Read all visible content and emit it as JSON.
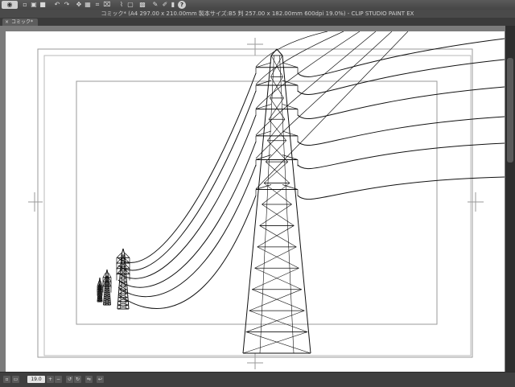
{
  "window": {
    "title": "コミック* (A4 297.00 x 210.00mm 製本サイズ:B5 判 257.00 x 182.00mm 600dpi 19.0%) - CLIP STUDIO PAINT EX"
  },
  "toolbar": {
    "icons": [
      "eye-icon",
      "new-file-icon",
      "open-file-icon",
      "save-icon",
      "undo-icon",
      "redo-icon",
      "transform-icon",
      "cut-icon",
      "crop-icon",
      "select-icon",
      "lasso-icon",
      "clear-icon",
      "fill-icon",
      "pen-icon",
      "help-icon"
    ]
  },
  "tabs": [
    {
      "label": "コミック*"
    }
  ],
  "status": {
    "zoom": "19.0"
  },
  "colors": {
    "ui_dark": "#3a3a3a",
    "canvas_bg": "#7b7b7b",
    "paper": "#ffffff",
    "guide": "#9a9a9a"
  }
}
